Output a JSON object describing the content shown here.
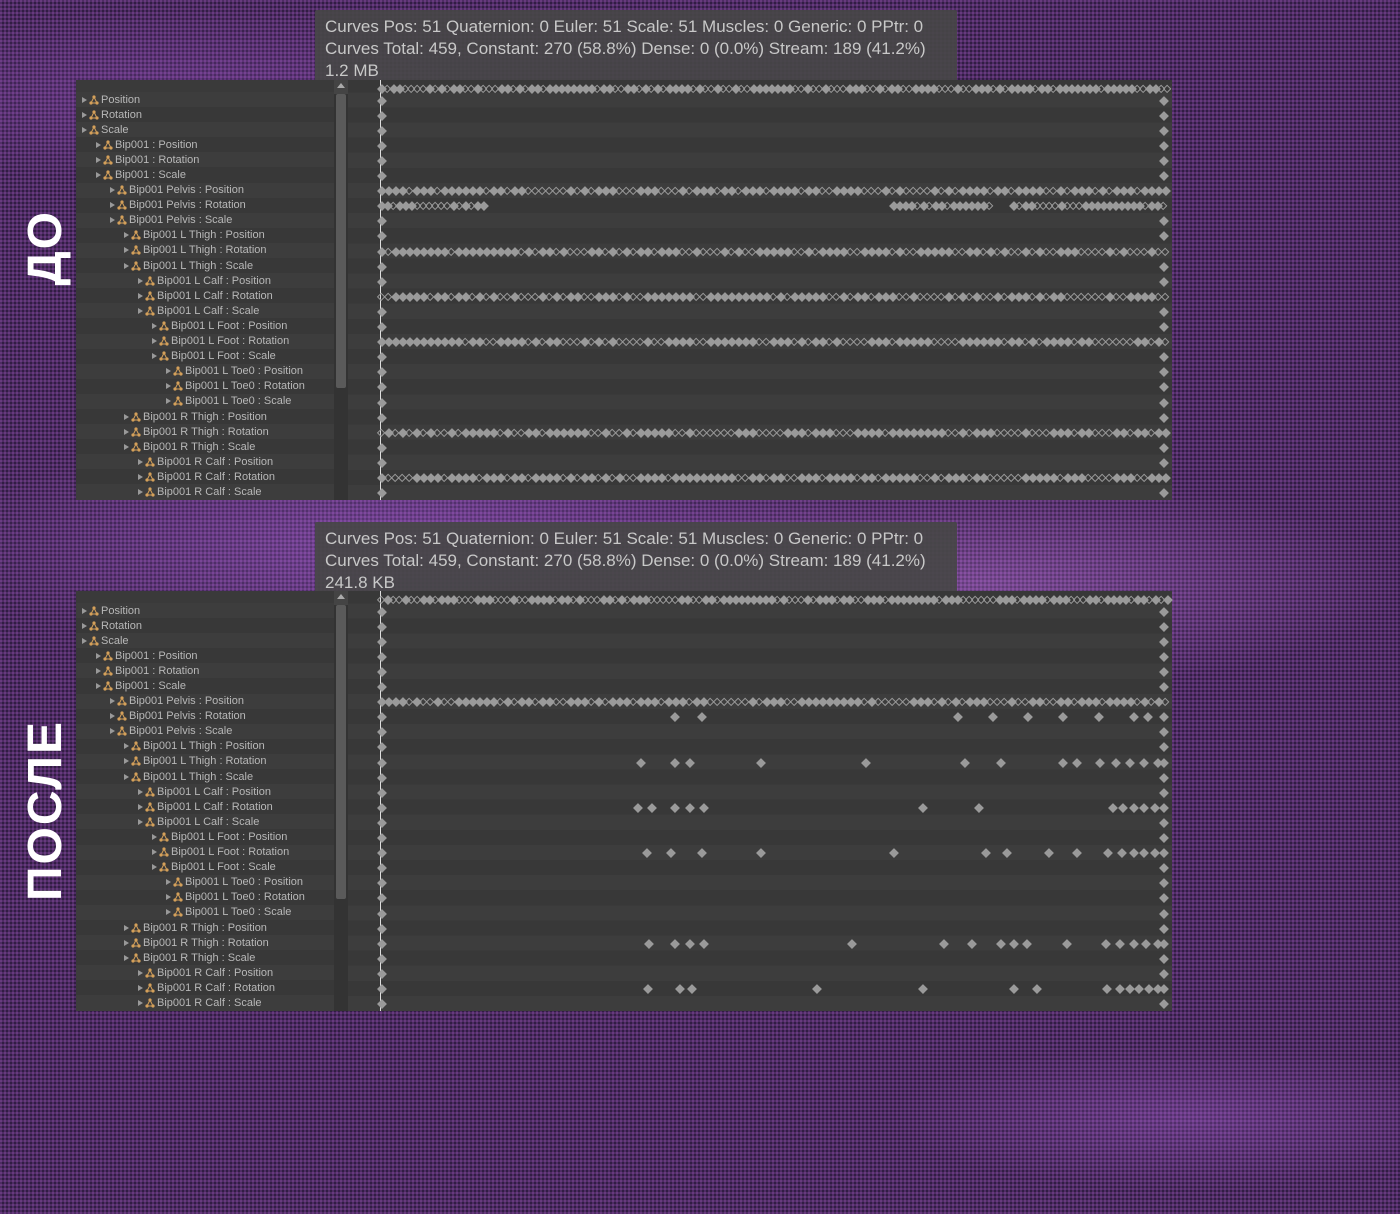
{
  "labels": {
    "before": "ДО",
    "after": "ПОСЛЕ"
  },
  "info_top": {
    "line1": "Curves Pos: 51 Quaternion: 0 Euler: 51 Scale: 51 Muscles: 0 Generic: 0 PPtr: 0",
    "line2": "Curves Total: 459, Constant: 270 (58.8%) Dense: 0 (0.0%) Stream: 189 (41.2%)",
    "line3": "1.2 MB"
  },
  "info_bottom": {
    "line1": "Curves Pos: 51 Quaternion: 0 Euler: 51 Scale: 51 Muscles: 0 Generic: 0 PPtr: 0",
    "line2": "Curves Total: 459, Constant: 270 (58.8%) Dense: 0 (0.0%) Stream: 189 (41.2%)",
    "line3": "241.8 KB"
  },
  "tree": [
    {
      "indent": 0,
      "label": "Position"
    },
    {
      "indent": 0,
      "label": "Rotation"
    },
    {
      "indent": 0,
      "label": "Scale"
    },
    {
      "indent": 1,
      "label": "Bip001 : Position"
    },
    {
      "indent": 1,
      "label": "Bip001 : Rotation"
    },
    {
      "indent": 1,
      "label": "Bip001 : Scale"
    },
    {
      "indent": 2,
      "label": "Bip001 Pelvis : Position"
    },
    {
      "indent": 2,
      "label": "Bip001 Pelvis : Rotation"
    },
    {
      "indent": 2,
      "label": "Bip001 Pelvis : Scale"
    },
    {
      "indent": 3,
      "label": "Bip001 L Thigh : Position"
    },
    {
      "indent": 3,
      "label": "Bip001 L Thigh : Rotation"
    },
    {
      "indent": 3,
      "label": "Bip001 L Thigh : Scale"
    },
    {
      "indent": 4,
      "label": "Bip001 L Calf : Position"
    },
    {
      "indent": 4,
      "label": "Bip001 L Calf : Rotation"
    },
    {
      "indent": 4,
      "label": "Bip001 L Calf : Scale"
    },
    {
      "indent": 5,
      "label": "Bip001 L Foot : Position"
    },
    {
      "indent": 5,
      "label": "Bip001 L Foot : Rotation"
    },
    {
      "indent": 5,
      "label": "Bip001 L Foot : Scale"
    },
    {
      "indent": 6,
      "label": "Bip001 L Toe0 : Position"
    },
    {
      "indent": 6,
      "label": "Bip001 L Toe0 : Rotation"
    },
    {
      "indent": 6,
      "label": "Bip001 L Toe0 : Scale"
    },
    {
      "indent": 3,
      "label": "Bip001 R Thigh : Position"
    },
    {
      "indent": 3,
      "label": "Bip001 R Thigh : Rotation"
    },
    {
      "indent": 3,
      "label": "Bip001 R Thigh : Scale"
    },
    {
      "indent": 4,
      "label": "Bip001 R Calf : Position"
    },
    {
      "indent": 4,
      "label": "Bip001 R Calf : Rotation"
    },
    {
      "indent": 4,
      "label": "Bip001 R Calf : Scale"
    }
  ],
  "keys_top": {
    "ruler": "dense",
    "rows": {
      "1": [
        32,
        1143
      ],
      "2": [
        32,
        1143
      ],
      "3": [
        32,
        1143
      ],
      "4": [
        32,
        1143
      ],
      "5": [
        32,
        1143
      ],
      "6": [
        32,
        1143
      ],
      "7": "dense",
      "8": "cluster",
      "9": [
        32,
        1143
      ],
      "10": [
        32,
        1143
      ],
      "11": "dense",
      "12": [
        32,
        1143
      ],
      "13": [
        32,
        1143
      ],
      "14": "dense",
      "15": [
        32,
        1143
      ],
      "16": [
        32,
        1143
      ],
      "17": "dense",
      "18": [
        32,
        1143
      ],
      "19": [
        32,
        1143
      ],
      "20": [
        32,
        1143
      ],
      "21": [
        32,
        1143
      ],
      "22": [
        32,
        1143
      ],
      "23": "dense",
      "24": [
        32,
        1143
      ],
      "25": [
        32,
        1143
      ],
      "26": "dense",
      "27": [
        32,
        1143
      ]
    }
  },
  "keys_bottom": {
    "ruler": "dense",
    "rows": {
      "1": [
        32,
        1143
      ],
      "2": [
        32,
        1143
      ],
      "3": [
        32,
        1143
      ],
      "4": [
        32,
        1143
      ],
      "5": [
        32,
        1143
      ],
      "6": [
        32,
        1143
      ],
      "7": "dense",
      "8": [
        32,
        448,
        486,
        850,
        900,
        950,
        1000,
        1050,
        1100,
        1120,
        1143
      ],
      "9": [
        32,
        1143
      ],
      "10": [
        32,
        1143
      ],
      "11": [
        32,
        400,
        448,
        470,
        570,
        720,
        860,
        912,
        1000,
        1020,
        1052,
        1075,
        1095,
        1115,
        1135,
        1143
      ],
      "12": [
        32,
        1143
      ],
      "13": [
        32,
        1143
      ],
      "14": [
        32,
        396,
        415,
        448,
        470,
        490,
        800,
        880,
        1070,
        1085,
        1100,
        1115,
        1130,
        1143
      ],
      "15": [
        32,
        1143
      ],
      "16": [
        32,
        1143
      ],
      "17": [
        32,
        408,
        442,
        486,
        570,
        760,
        890,
        920,
        980,
        1020,
        1063,
        1083,
        1100,
        1115,
        1130,
        1143
      ],
      "18": [
        32,
        1143
      ],
      "19": [
        32,
        1143
      ],
      "20": [
        32,
        1143
      ],
      "21": [
        32,
        1143
      ],
      "22": [
        32,
        1143
      ],
      "23": [
        32,
        412,
        448,
        470,
        490,
        700,
        830,
        870,
        912,
        930,
        948,
        1005,
        1060,
        1080,
        1100,
        1118,
        1135,
        1143
      ],
      "24": [
        32,
        1143
      ],
      "25": [
        32,
        1143
      ],
      "26": [
        32,
        410,
        455,
        472,
        650,
        800,
        930,
        962,
        1062,
        1080,
        1095,
        1108,
        1122,
        1135,
        1143
      ],
      "27": [
        32,
        1143
      ]
    }
  }
}
